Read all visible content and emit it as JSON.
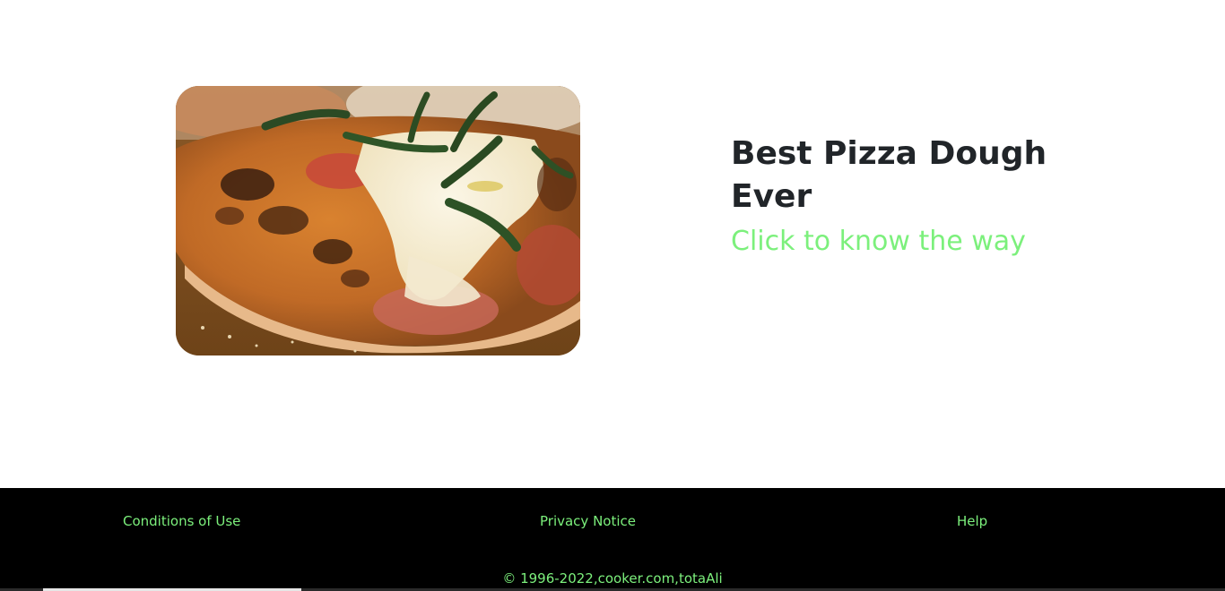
{
  "recipe": {
    "image_alt": "Pizza",
    "title": "Best Pizza Dough Ever",
    "link_text": "Click to know the way"
  },
  "footer": {
    "links": [
      {
        "label": "Conditions of Use"
      },
      {
        "label": "Privacy Notice"
      },
      {
        "label": "Help"
      }
    ],
    "copyright": "© 1996-2022,cooker.com,totaAli"
  },
  "colors": {
    "link_green": "#7cf07c",
    "footer_background": "#000000",
    "heading_text": "#212529"
  }
}
